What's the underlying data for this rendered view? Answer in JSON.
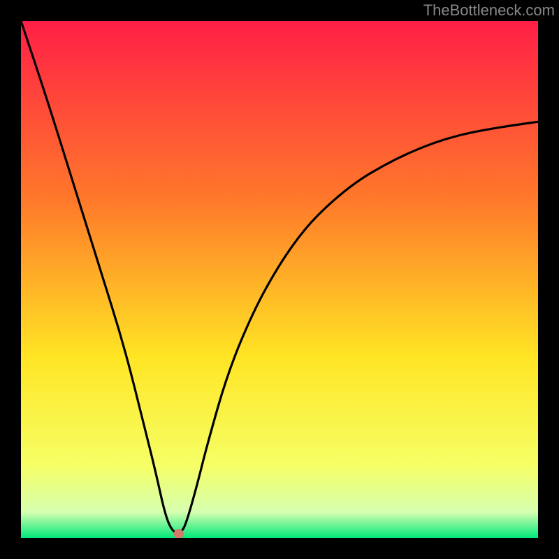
{
  "watermark": "TheBottleneck.com",
  "colors": {
    "frame": "#000000",
    "gradient_top": "#ff1f46",
    "gradient_mid1": "#ff7a2a",
    "gradient_mid2": "#ffe524",
    "gradient_low1": "#f6ff66",
    "gradient_low2": "#d6ffb0",
    "gradient_bottom": "#00e87a",
    "curve": "#000000",
    "marker": "#d6786b"
  },
  "chart_data": {
    "type": "line",
    "title": "",
    "xlabel": "",
    "ylabel": "",
    "xlim": [
      0,
      100
    ],
    "ylim": [
      0,
      100
    ],
    "grid": false,
    "series": [
      {
        "name": "bottleneck-curve",
        "x": [
          0,
          5,
          10,
          15,
          20,
          24,
          26,
          28,
          29.5,
          31,
          32,
          34,
          36,
          40,
          45,
          50,
          55,
          60,
          65,
          70,
          75,
          80,
          85,
          90,
          95,
          100
        ],
        "values": [
          100,
          85,
          69,
          53,
          37,
          21,
          13,
          4,
          1,
          1,
          3,
          10,
          18,
          32,
          44,
          53,
          60,
          65,
          69,
          72,
          74.5,
          76.5,
          78,
          79,
          79.8,
          80.5
        ]
      }
    ],
    "annotations": [
      {
        "name": "min-marker",
        "x": 30.5,
        "y": 0.8
      }
    ],
    "notes": "V-shaped bottleneck curve over a vertical red→orange→yellow→green gradient background; minimum near x≈30."
  }
}
